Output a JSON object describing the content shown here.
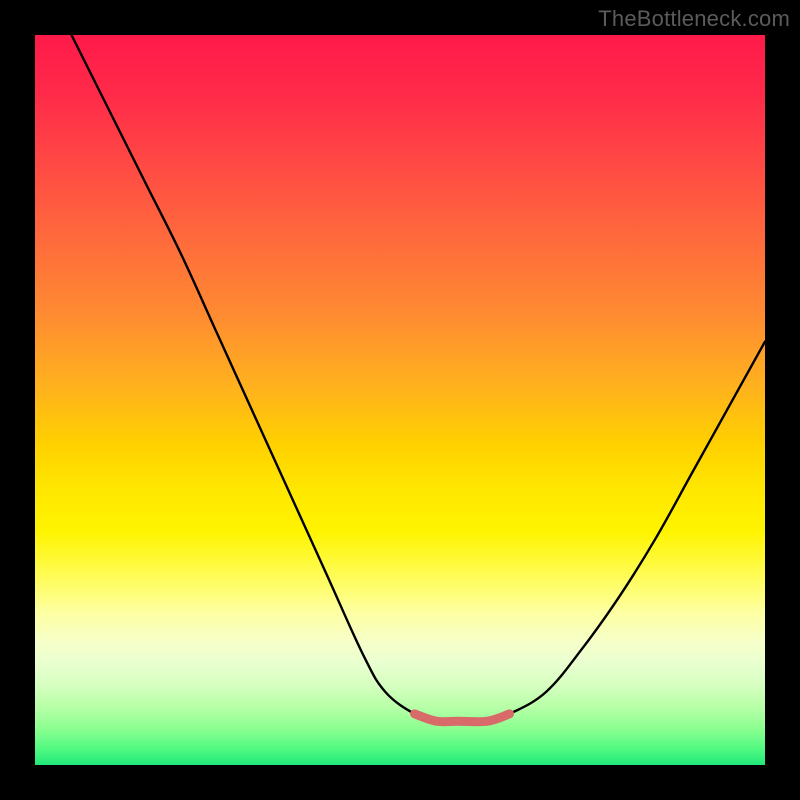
{
  "watermark_text": "TheBottleneck.com",
  "colors": {
    "frame_bg": "#000000",
    "curve_stroke": "#000000",
    "trough_stroke": "#d86a6a",
    "gradient_stops": [
      "#ff1a4a",
      "#ff2a49",
      "#ff4a44",
      "#ff6a3c",
      "#ff8a32",
      "#ffb11e",
      "#ffd000",
      "#ffe600",
      "#fff400",
      "#fffc55",
      "#fdffa0",
      "#f7ffc8",
      "#e9ffd0",
      "#d6ffc0",
      "#b8ffa8",
      "#8cff90",
      "#4cf880",
      "#20e87a"
    ]
  },
  "chart_data": {
    "type": "line",
    "title": "",
    "xlabel": "",
    "ylabel": "",
    "xlim": [
      0,
      100
    ],
    "ylim": [
      0,
      100
    ],
    "grid": false,
    "note": "Bottleneck-style V curve. X is a normalized parameter (0-100). Y is approximate bottleneck percentage where 0 is ideal (green) and 100 is worst (red). Trough (flat minimum) highlighted separately.",
    "series": [
      {
        "name": "bottleneck-curve",
        "x": [
          5,
          10,
          15,
          20,
          25,
          30,
          35,
          40,
          45,
          48,
          52,
          55,
          58,
          62,
          65,
          70,
          75,
          80,
          85,
          90,
          95,
          100
        ],
        "y": [
          100,
          90,
          80,
          70,
          59,
          48,
          37,
          26,
          15,
          10,
          7,
          6,
          6,
          6,
          7,
          10,
          16,
          23,
          31,
          40,
          49,
          58
        ]
      },
      {
        "name": "optimal-zone",
        "x": [
          52,
          55,
          58,
          62,
          65
        ],
        "y": [
          7,
          6,
          6,
          6,
          7
        ]
      }
    ]
  }
}
